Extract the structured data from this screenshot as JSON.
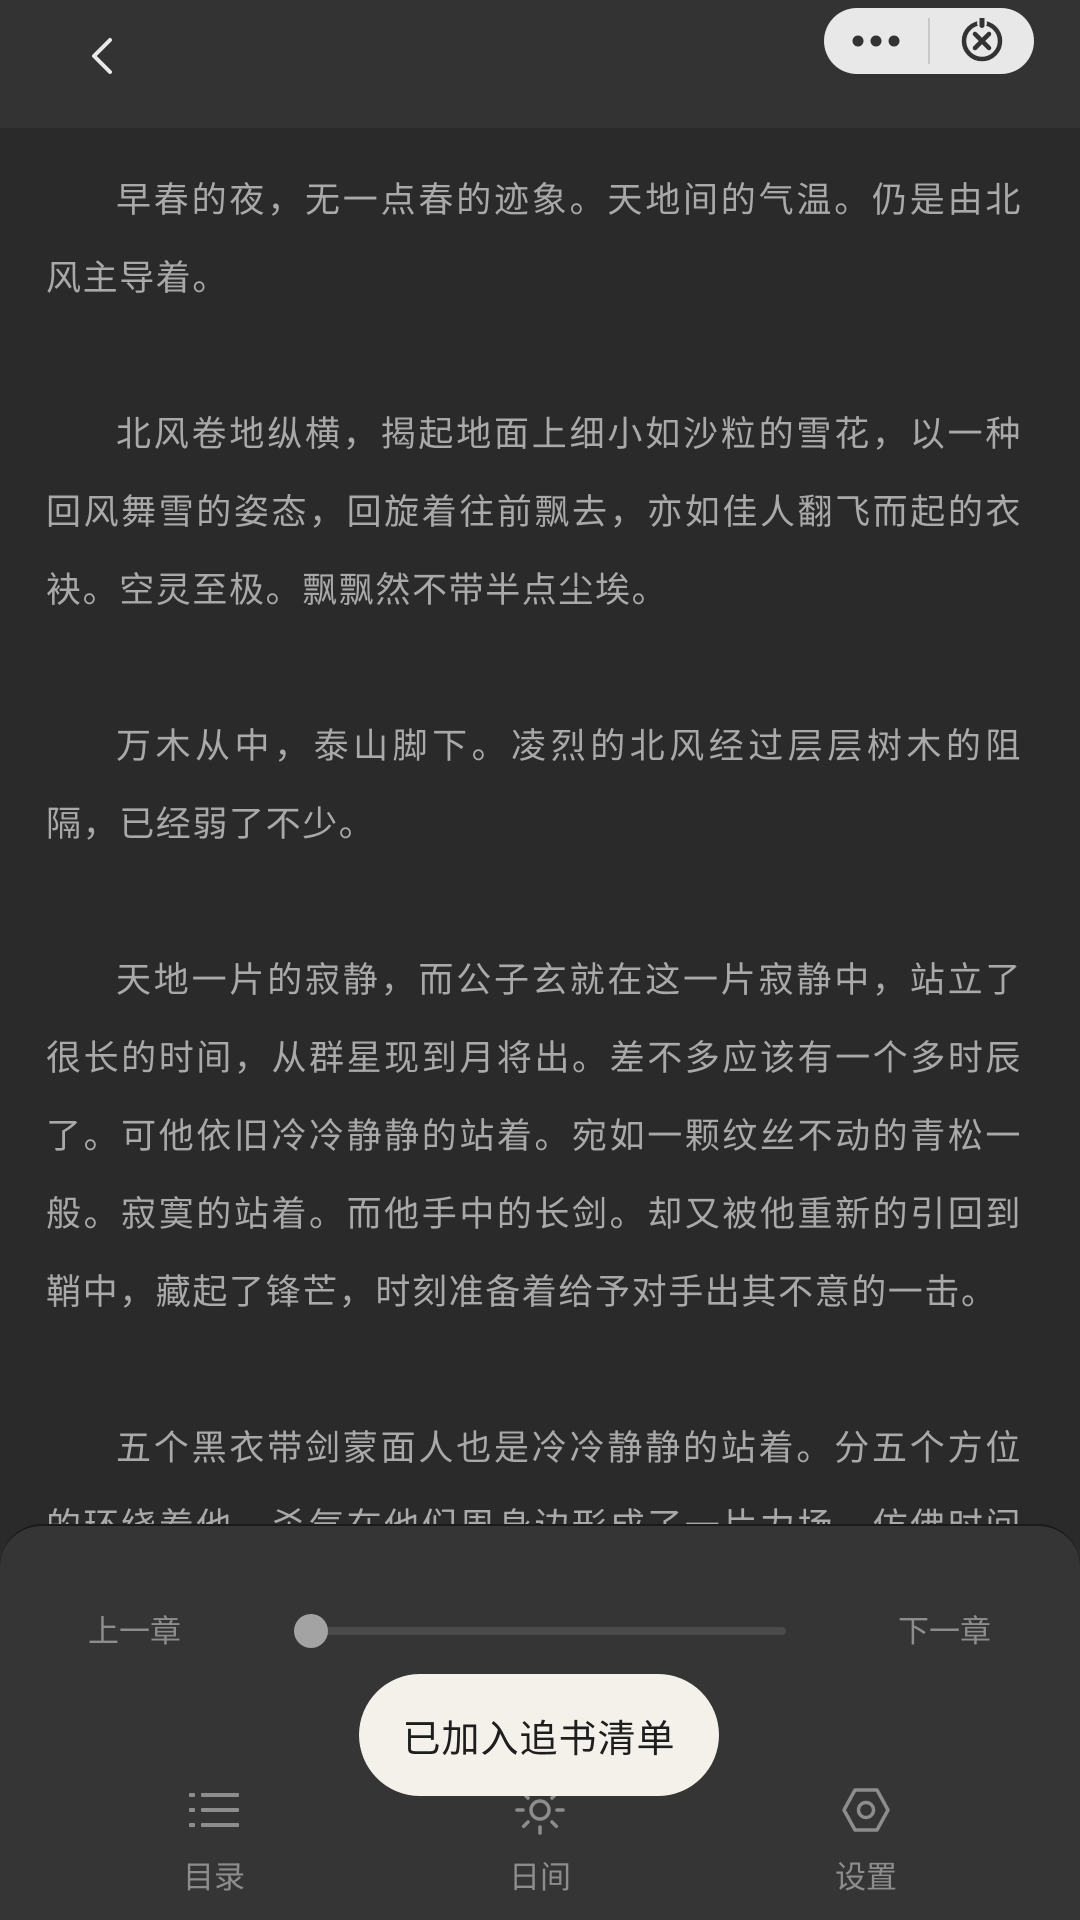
{
  "reader": {
    "paragraphs": [
      "早春的夜，无一点春的迹象。天地间的气温。仍是由北风主导着。",
      "北风卷地纵横，揭起地面上细小如沙粒的雪花，以一种回风舞雪的姿态，回旋着往前飘去，亦如佳人翻飞而起的衣袂。空灵至极。飘飘然不带半点尘埃。",
      "万木从中，泰山脚下。凌烈的北风经过层层树木的阻隔，已经弱了不少。",
      "天地一片的寂静，而公子玄就在这一片寂静中，站立了很长的时间，从群星现到月将出。差不多应该有一个多时辰了。可他依旧冷冷静静的站着。宛如一颗纹丝不动的青松一般。寂寞的站着。而他手中的长剑。却又被他重新的引回到鞘中，藏起了锋芒，时刻准备着给予对手出其不意的一击。",
      "五个黑衣带剑蒙面人也是冷冷静静的站着。分五个方位的环绕着他，杀气在他们周身边形成了一片力场，仿佛时间到了这"
    ]
  },
  "controls": {
    "prev_chapter": "上一章",
    "next_chapter": "下一章",
    "progress": 0
  },
  "tabs": {
    "toc": "目录",
    "day_mode": "日间",
    "settings": "设置"
  },
  "toast": {
    "message": "已加入追书清单"
  },
  "icons": {
    "back": "chevron-left-icon",
    "more": "more-dots-icon",
    "close": "close-circle-icon",
    "toc": "list-icon",
    "day_mode": "sun-icon",
    "settings": "hexagon-gear-icon"
  }
}
